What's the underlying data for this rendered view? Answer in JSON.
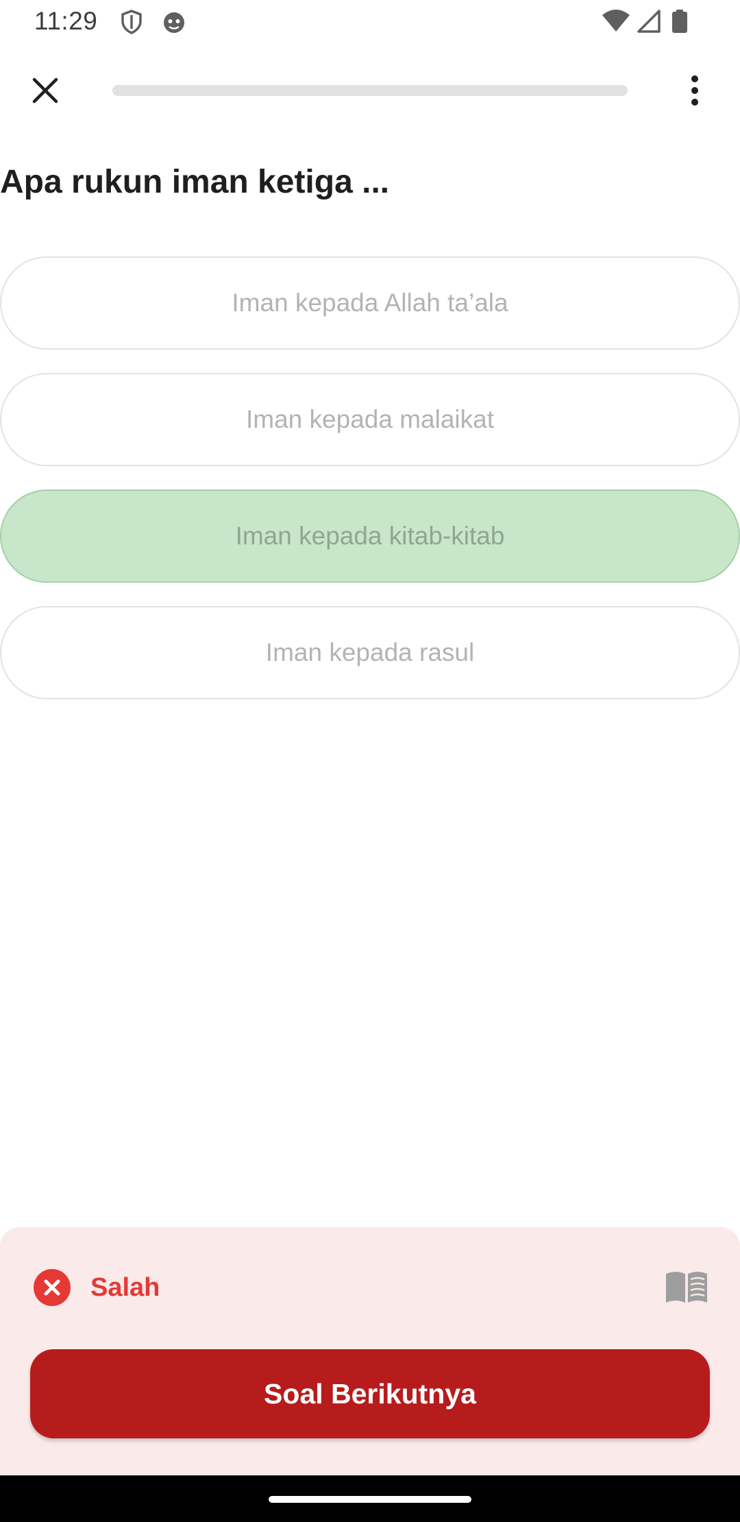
{
  "status_bar": {
    "time": "11:29",
    "icons": [
      "shield-icon",
      "smiley-icon",
      "wifi-icon",
      "signal-icon",
      "battery-icon"
    ]
  },
  "top_bar": {
    "close_icon": "close-icon",
    "progress_fraction": 0,
    "more_icon": "more-vertical-icon"
  },
  "question": {
    "text": "Apa rukun iman ketiga ..."
  },
  "options": [
    {
      "label": "Iman kepada Allah ta’ala",
      "selected": false
    },
    {
      "label": "Iman kepada malaikat",
      "selected": false
    },
    {
      "label": "Iman kepada kitab-kitab",
      "selected": true
    },
    {
      "label": "Iman kepada rasul",
      "selected": false
    }
  ],
  "feedback": {
    "status_label": "Salah",
    "status_icon": "error-x-icon",
    "book_icon": "open-book-icon",
    "next_button_label": "Soal Berikutnya"
  },
  "colors": {
    "accent": "#b71c1c",
    "error": "#e53935",
    "selected_option": "#c8e6c9",
    "feedback_bg": "#fbeaea"
  }
}
